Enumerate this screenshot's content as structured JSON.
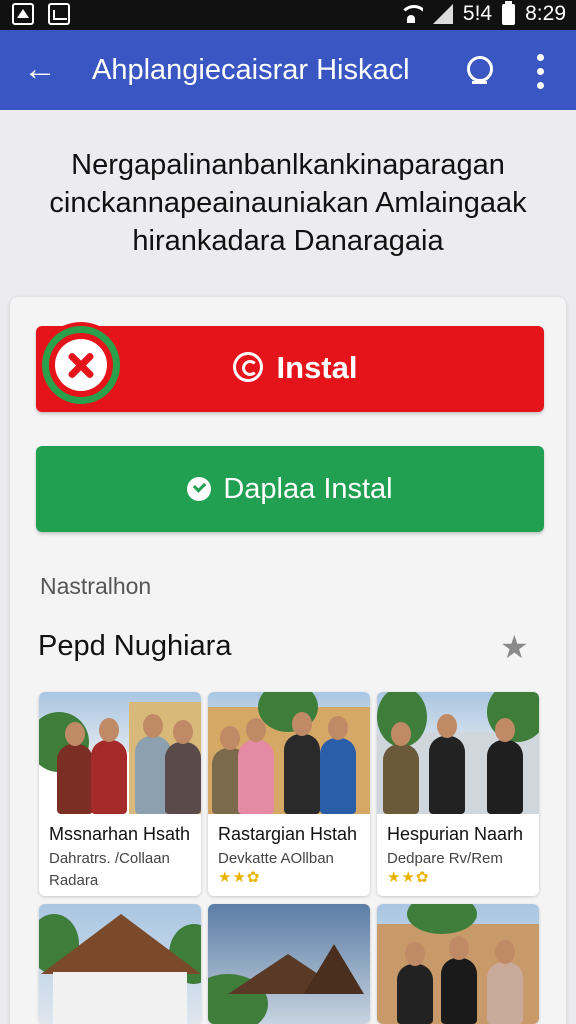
{
  "status_bar": {
    "time": "8:29",
    "network": "5!4"
  },
  "app_bar": {
    "title": "Ahplangiecaisrar Hiskacl"
  },
  "headline": {
    "line1": "Nergapalinanbanlkankinaparagan",
    "line2": "cinckannapeainauniakan Amlaingaak",
    "line3": "hirankadara Danaragaia"
  },
  "install_button": {
    "label": "Instal",
    "accent": "#e5131a"
  },
  "download_button": {
    "label": "Daplaa Instal",
    "accent": "#22a052"
  },
  "section": {
    "subtitle": "Nastralhon",
    "title": "Pepd Nughiara"
  },
  "tiles": [
    {
      "name": "Mssnarhan Hsath",
      "meta": "Dahratrs. /Collaan",
      "meta2": "Radara",
      "rating": ""
    },
    {
      "name": "Rastargian Hstah",
      "meta": "Devkatte AOllban",
      "meta2": "",
      "rating": "★★✿"
    },
    {
      "name": "Hespurian Naarh",
      "meta": "Dedpare Rv/Rem",
      "meta2": "",
      "rating": "★★✿"
    }
  ],
  "icons": [
    "back-arrow-icon",
    "search-icon",
    "more-vert-icon",
    "close-icon",
    "copyright-icon",
    "check-icon",
    "star-icon",
    "wifi-icon",
    "signal-icon",
    "battery-icon"
  ]
}
